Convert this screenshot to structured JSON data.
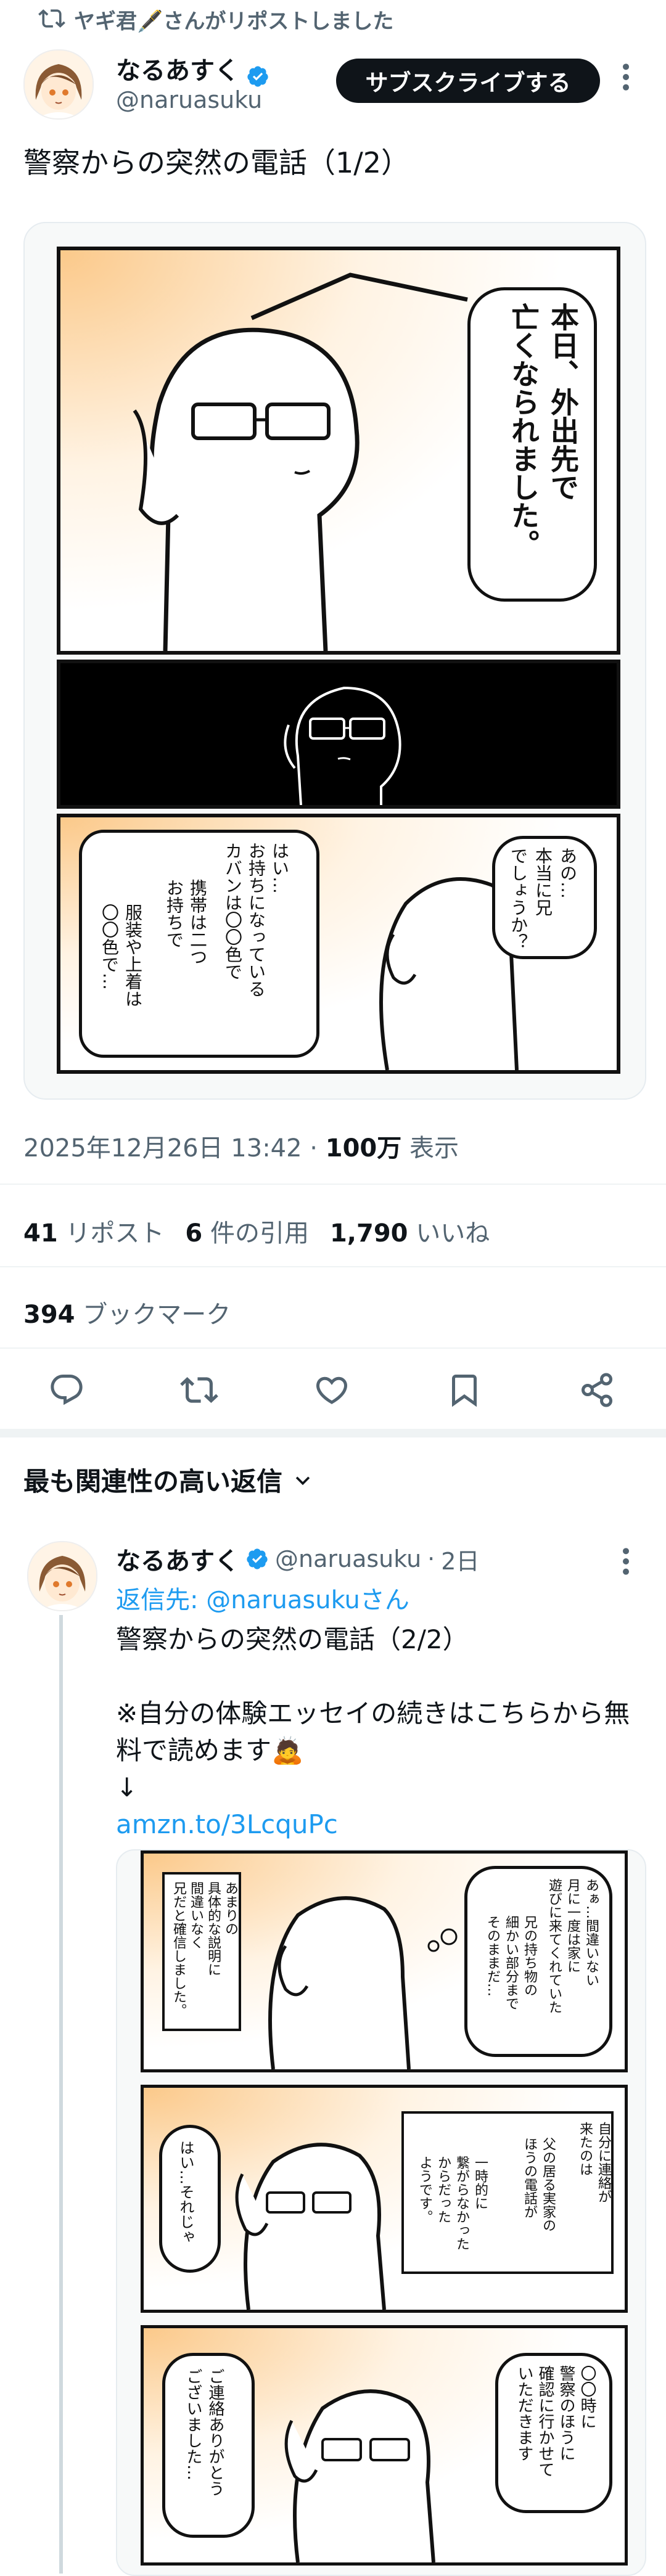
{
  "repost": {
    "text": "ヤギ君🖋️さんがリポストしました"
  },
  "post": {
    "author_name": "なるあすく",
    "author_handle": "@naruasuku",
    "subscribe_label": "サブスクライブする",
    "text": "警察からの突然の電話（1/2）",
    "comic": {
      "panel1_text": "本日、外出先で\n亡くなられました。",
      "panel3_bubble_right": "あの…\n本当に兄\nでしょうか？",
      "panel3_bubble_left_1": "はい…\nお持ちになっている\nカバンは〇〇色で",
      "panel3_bubble_left_2": "携帯は二つ\nお持ちで",
      "panel3_bubble_left_3": "服装や上着は\n〇〇色で…"
    },
    "timestamp": "2025年12月26日 13:42",
    "views_count": "100万",
    "views_label": "表示",
    "reposts_count": "41",
    "reposts_label": "リポスト",
    "quotes_count": "6",
    "quotes_label": "件の引用",
    "likes_count": "1,790",
    "likes_label": "いいね",
    "bookmarks_count": "394",
    "bookmarks_label": "ブックマーク"
  },
  "actions": [
    "reply-icon",
    "repost-icon",
    "like-icon",
    "bookmark-icon",
    "share-icon"
  ],
  "sort": {
    "label": "最も関連性の高い返信"
  },
  "reply": {
    "author_name": "なるあすく",
    "author_handle": "@naruasuku",
    "age": "2日",
    "reply_to_prefix": "返信先: ",
    "reply_to_handle": "@naruasukuさん",
    "text": "警察からの突然の電話（2/2）\n\n※自分の体験エッセイの続きはこちらから無料で読めます🙇\n↓",
    "link": "amzn.to/3LcquPc",
    "comic": {
      "p1_right": "あぁ…間違いない\n月に一度は家に\n遊びに来てくれていた",
      "p1_right2": "兄の持ち物の\n細かい部分まで\nそのままだ…",
      "p1_left": "あまりの\n具体的な説明に\n間違いなく\n兄だと確信しました。",
      "p2_right": "自分に連絡が\n来たのは",
      "p2_right2": "父の居る実家の\nほうの電話が",
      "p2_right3": "一時的に\n繋がらなかった\nからだった\nようです。",
      "p2_left": "はい…それじゃ",
      "p3_right": "〇〇時に\n警察のほうに\n確認に行かせて\nいただきます",
      "p3_left": "ご連絡ありがとう\nございました…"
    }
  },
  "colors": {
    "accent": "#1d9bf0",
    "muted": "#536471",
    "text": "#0f1419",
    "panel_glow": "#fbd7a8"
  }
}
